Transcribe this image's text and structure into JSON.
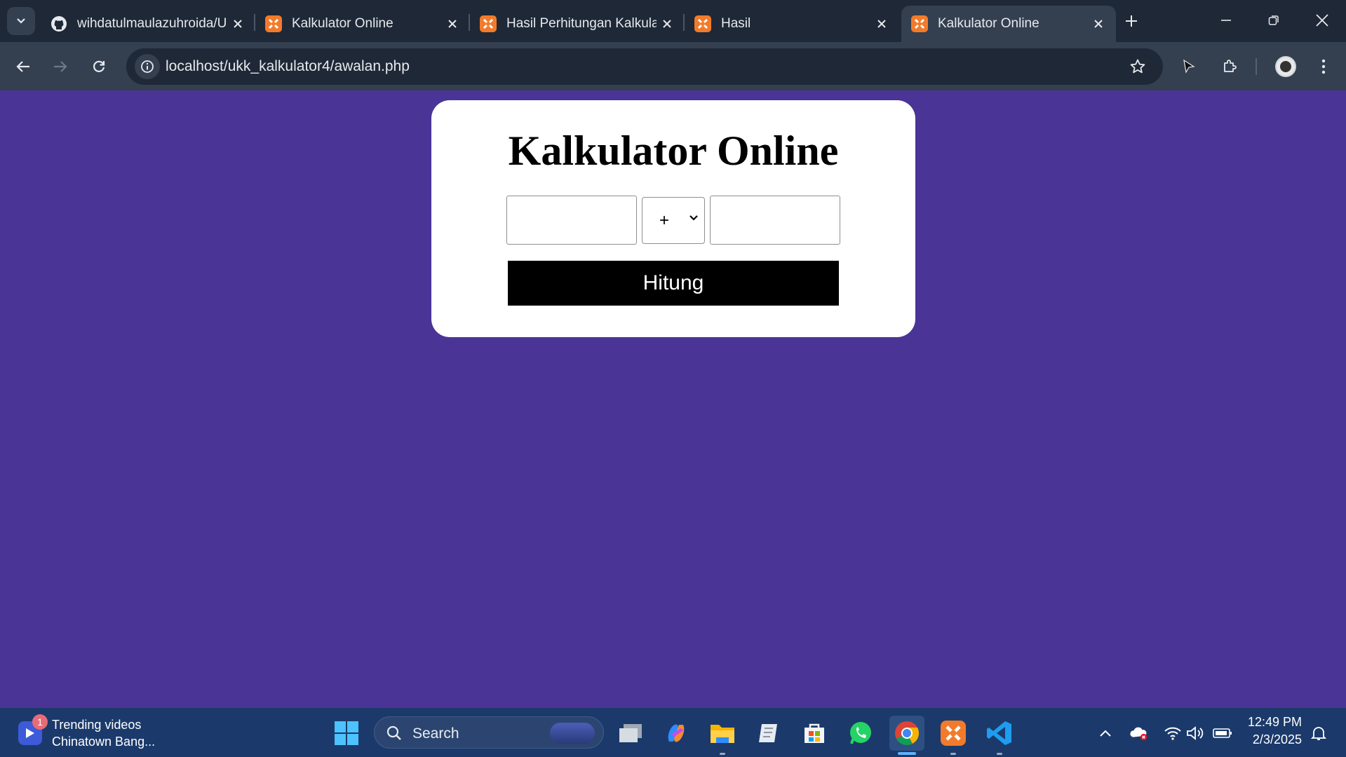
{
  "browser": {
    "tabs": [
      {
        "title": "wihdatulmaulazuhroida/U",
        "favicon": "github-icon",
        "active": false
      },
      {
        "title": "Kalkulator Online",
        "favicon": "xampp-icon",
        "active": false
      },
      {
        "title": "Hasil Perhitungan Kalkula",
        "favicon": "xampp-icon",
        "active": false
      },
      {
        "title": "Hasil",
        "favicon": "xampp-icon",
        "active": false
      },
      {
        "title": "Kalkulator Online",
        "favicon": "xampp-icon",
        "active": true
      }
    ],
    "url": "localhost/ukk_kalkulator4/awalan.php"
  },
  "page": {
    "title": "Kalkulator Online",
    "input1": {
      "value": "",
      "placeholder": ""
    },
    "operator": {
      "selected": "+",
      "options": [
        "+"
      ]
    },
    "input2": {
      "value": "",
      "placeholder": ""
    },
    "submit_label": "Hitung",
    "background_color": "#4a3496"
  },
  "taskbar": {
    "widget": {
      "badge": "1",
      "line1": "Trending videos",
      "line2": "Chinatown Bang..."
    },
    "search_label": "Search",
    "apps": [
      "start-icon",
      "task-view-icon",
      "copilot-icon",
      "file-explorer-icon",
      "notepad-icon",
      "microsoft-store-icon",
      "whatsapp-icon",
      "chrome-icon",
      "xampp-icon",
      "vscode-icon"
    ],
    "clock": {
      "time": "12:49 PM",
      "date": "2/3/2025"
    }
  }
}
